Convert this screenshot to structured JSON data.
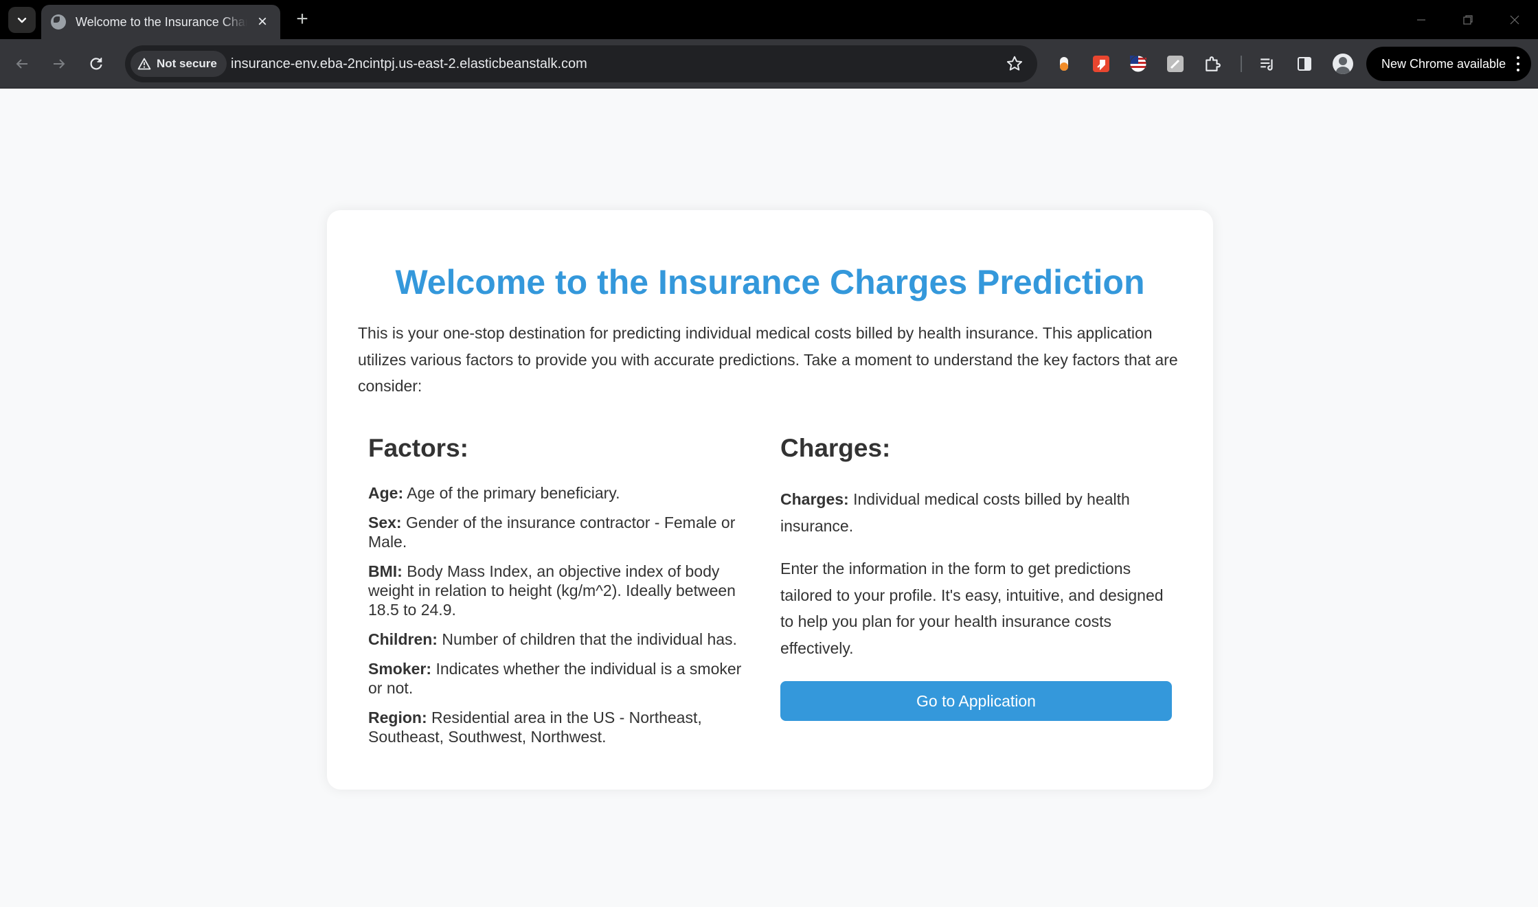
{
  "browser": {
    "tab_title": "Welcome to the Insurance Charges Prediction",
    "security_label": "Not secure",
    "url": "insurance-env.eba-2ncintpj.us-east-2.elasticbeanstalk.com",
    "update_label": "New Chrome available"
  },
  "page": {
    "title": "Welcome to the Insurance Charges Prediction",
    "intro": "This is your one-stop destination for predicting individual medical costs billed by health insurance. This application utilizes various factors to provide you with accurate predictions. Take a moment to understand the key factors that are consider:",
    "factors_heading": "Factors:",
    "factors": [
      {
        "label": "Age:",
        "text": "Age of the primary beneficiary."
      },
      {
        "label": "Sex:",
        "text": "Gender of the insurance contractor - Female or Male."
      },
      {
        "label": "BMI:",
        "text": "Body Mass Index, an objective index of body weight in relation to height (kg/m^2). Ideally between 18.5 to 24.9."
      },
      {
        "label": "Children:",
        "text": "Number of children that the individual has."
      },
      {
        "label": "Smoker:",
        "text": "Indicates whether the individual is a smoker or not."
      },
      {
        "label": "Region:",
        "text": "Residential area in the US - Northeast, Southeast, Southwest, Northwest."
      }
    ],
    "charges_heading": "Charges:",
    "charges_label": "Charges:",
    "charges_text": "Individual medical costs billed by health insurance.",
    "info_text": "Enter the information in the form to get predictions tailored to your profile. It's easy, intuitive, and designed to help you plan for your health insurance costs effectively.",
    "button_label": "Go to Application"
  },
  "colors": {
    "accent": "#3498db",
    "text": "#333333",
    "page_bg": "#f8f9fa"
  },
  "icons": {
    "tab_search": "chevron-down-icon",
    "favicon": "globe-icon",
    "security": "warning-triangle-icon",
    "bookmark": "star-icon"
  }
}
